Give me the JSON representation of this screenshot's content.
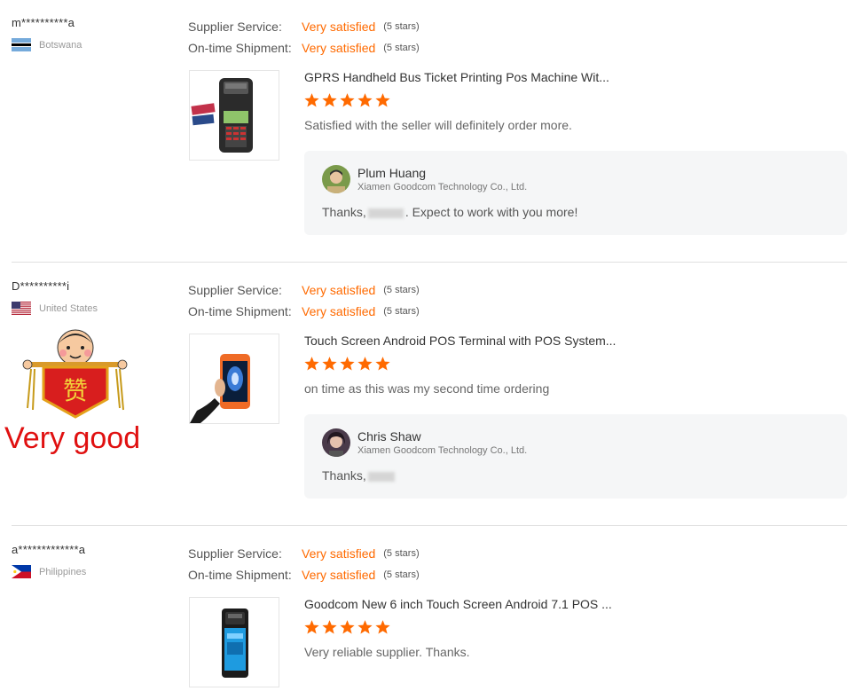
{
  "reviews": [
    {
      "buyer": "m**********a",
      "country": "Botswana",
      "flag": "botswana",
      "supplier_service_label": "Supplier Service:",
      "supplier_service_value": "Very satisfied",
      "supplier_service_stars": "(5 stars)",
      "shipment_label": "On-time Shipment:",
      "shipment_value": "Very satisfied",
      "shipment_stars": "(5 stars)",
      "product_title": "GPRS Handheld Bus Ticket Printing Pos Machine Wit...",
      "rating": 5,
      "text": "Satisfied with the seller will definitely order more.",
      "reply": {
        "name": "Plum Huang",
        "company": "Xiamen Goodcom Technology Co., Ltd.",
        "text_before": "Thanks,",
        "text_after": ". Expect to work with you more!"
      }
    },
    {
      "buyer": "D**********i",
      "country": "United States",
      "flag": "usa",
      "supplier_service_label": "Supplier Service:",
      "supplier_service_value": "Very satisfied",
      "supplier_service_stars": "(5 stars)",
      "shipment_label": "On-time Shipment:",
      "shipment_value": "Very satisfied",
      "shipment_stars": "(5 stars)",
      "product_title": "Touch Screen Android POS Terminal with POS System...",
      "rating": 5,
      "text": "on time as this was my second time ordering",
      "reply": {
        "name": "Chris Shaw",
        "company": "Xiamen Goodcom Technology Co., Ltd.",
        "text_before": "Thanks,",
        "text_after": ""
      }
    },
    {
      "buyer": "a*************a",
      "country": "Philippines",
      "flag": "philippines",
      "supplier_service_label": "Supplier Service:",
      "supplier_service_value": "Very satisfied",
      "supplier_service_stars": "(5 stars)",
      "shipment_label": "On-time Shipment:",
      "shipment_value": "Very satisfied",
      "shipment_stars": "(5 stars)",
      "product_title": "Goodcom New 6 inch Touch Screen Android 7.1 POS ...",
      "rating": 5,
      "text": "Very reliable supplier. Thanks."
    }
  ],
  "sticker": {
    "char": "赞",
    "caption": "Very good"
  },
  "colors": {
    "accent": "#ff6a00",
    "star": "#ff6a00",
    "reply_bg": "#f5f6f7"
  }
}
